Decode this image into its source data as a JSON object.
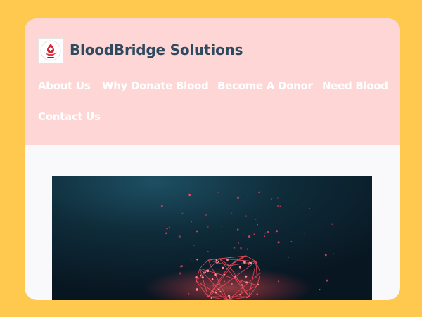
{
  "site": {
    "title": "BloodBridge Solutions",
    "logo_icon": "blood-donation-logo-icon"
  },
  "nav": {
    "items": [
      {
        "label": "About Us"
      },
      {
        "label": "Why Donate Blood"
      },
      {
        "label": "Become A Donor"
      },
      {
        "label": "Need Blood"
      },
      {
        "label": "Contact Us"
      }
    ]
  },
  "hero": {
    "image_icon": "glowing-network-heart-image"
  },
  "colors": {
    "page_background": "#ffc94f",
    "header_background": "#ffd6d6",
    "title_text": "#2e4a5f",
    "nav_text": "#ffffff",
    "hero_accent": "#ff3b4f"
  }
}
